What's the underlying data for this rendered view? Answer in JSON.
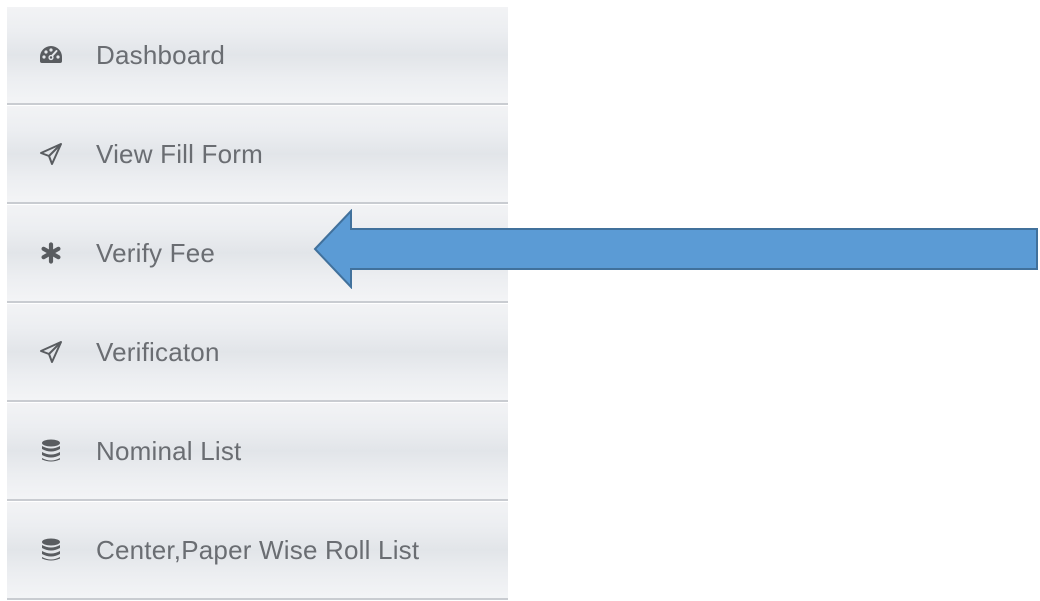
{
  "sidebar": {
    "items": [
      {
        "label": "Dashboard",
        "icon": "dashboard-icon"
      },
      {
        "label": "View Fill Form",
        "icon": "paper-plane-icon"
      },
      {
        "label": "Verify Fee",
        "icon": "asterisk-icon"
      },
      {
        "label": "Verificaton",
        "icon": "paper-plane-icon"
      },
      {
        "label": "Nominal List",
        "icon": "database-icon"
      },
      {
        "label": "Center,Paper Wise Roll List",
        "icon": "database-icon"
      }
    ]
  },
  "annotation": {
    "arrow_color": "#5b9bd5",
    "arrow_outline": "#41719c",
    "points_to": "Verify Fee"
  },
  "colors": {
    "item_text": "#6a6d72",
    "icon": "#595c60",
    "item_background": "#e6e8eb",
    "separator": "#c9ccd1"
  }
}
